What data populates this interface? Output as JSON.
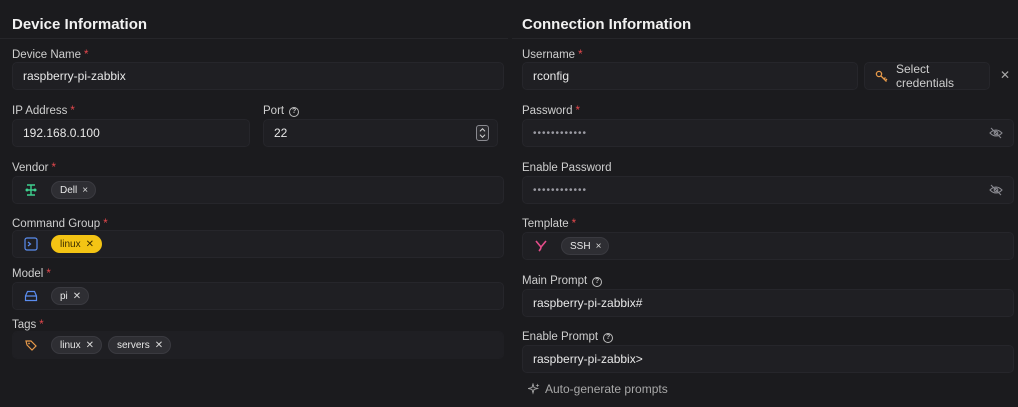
{
  "device": {
    "title": "Device Information",
    "device_name": {
      "label": "Device Name",
      "value": "raspberry-pi-zabbix"
    },
    "ip_address": {
      "label": "IP Address",
      "value": "192.168.0.100"
    },
    "port": {
      "label": "Port",
      "value": "22"
    },
    "vendor": {
      "label": "Vendor",
      "tags": [
        "Dell"
      ]
    },
    "command_group": {
      "label": "Command Group",
      "tags": [
        "linux"
      ]
    },
    "model": {
      "label": "Model",
      "tags": [
        "pi"
      ]
    },
    "tags": {
      "label": "Tags",
      "tags": [
        "linux",
        "servers"
      ]
    }
  },
  "connection": {
    "title": "Connection Information",
    "username": {
      "label": "Username",
      "value": "rconfig"
    },
    "select_credentials": "Select credentials",
    "password": {
      "label": "Password",
      "value": "••••••••••••"
    },
    "enable_password": {
      "label": "Enable Password",
      "value": "••••••••••••"
    },
    "template": {
      "label": "Template",
      "tags": [
        "SSH"
      ]
    },
    "main_prompt": {
      "label": "Main Prompt",
      "value": "raspberry-pi-zabbix#"
    },
    "enable_prompt": {
      "label": "Enable Prompt",
      "value": "raspberry-pi-zabbix>"
    },
    "auto_generate": "Auto-generate prompts"
  },
  "colors": {
    "background": "#1b1b1e",
    "required": "#e5484d",
    "tag_yellow": "#f4c414",
    "vendor_icon": "#3ecf8e",
    "template_icon": "#e44d8a",
    "tags_icon": "#e89a4a",
    "commandgroup_icon": "#5b8def"
  },
  "icons": [
    "help-icon",
    "network-icon",
    "terminal-icon",
    "drive-icon",
    "tag-icon",
    "key-icon",
    "eye-off-icon",
    "template-icon",
    "sparkle-icon",
    "stepper-icon",
    "close-icon"
  ]
}
